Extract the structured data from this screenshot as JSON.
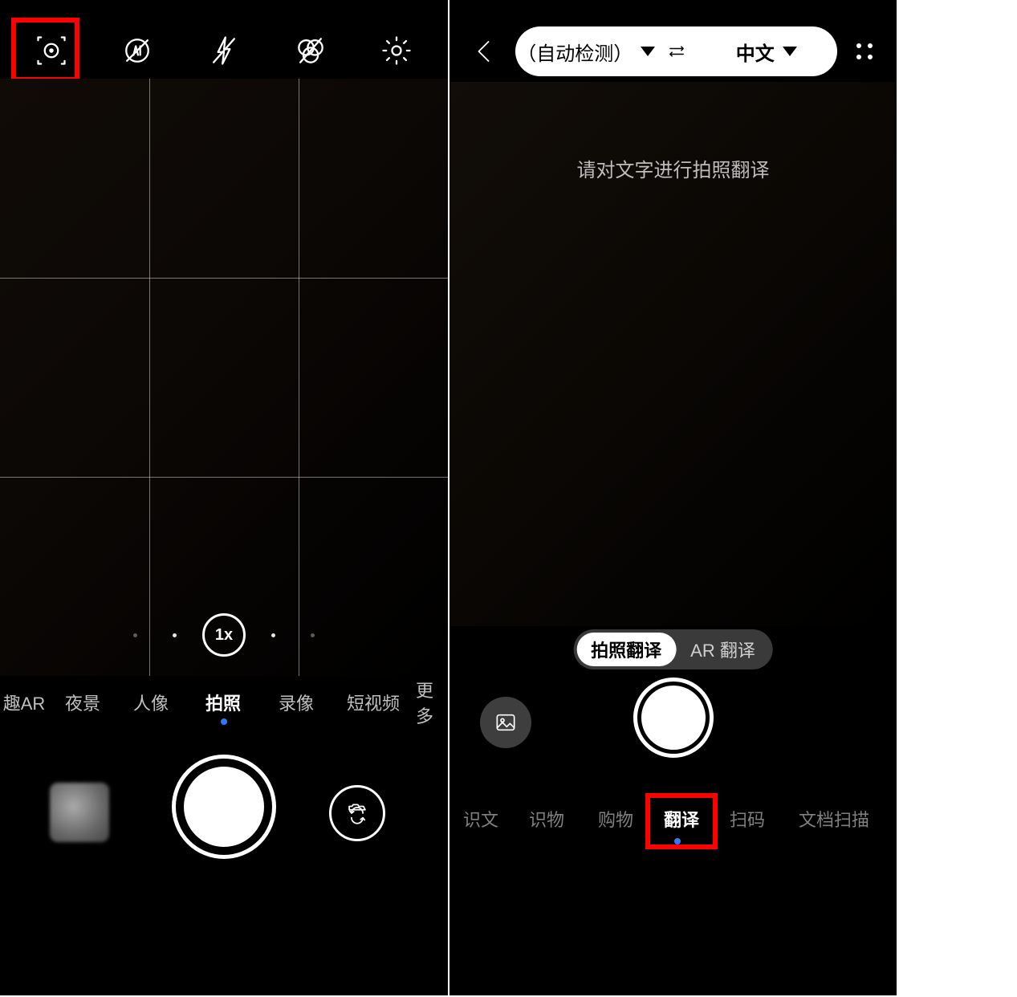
{
  "camera": {
    "top_icons": {
      "smart_lens": "smart-lens-icon",
      "ai": "ai-off-icon",
      "flash": "flash-off-icon",
      "filters": "filter-off-icon",
      "settings": "settings-icon"
    },
    "zoom_label": "1x",
    "modes": [
      "趣AR",
      "夜景",
      "人像",
      "拍照",
      "录像",
      "短视频",
      "更多"
    ],
    "active_mode_index": 3
  },
  "scanner": {
    "lang_from": "（自动检测）",
    "lang_to": "中文",
    "instruction": "请对文字进行拍照翻译",
    "switch_options": [
      "拍照翻译",
      "AR 翻译"
    ],
    "switch_active_index": 0,
    "modes": [
      "识文",
      "识物",
      "购物",
      "翻译",
      "扫码",
      "文档扫描"
    ],
    "active_mode_index": 3
  },
  "highlight_color": "#ff0000"
}
